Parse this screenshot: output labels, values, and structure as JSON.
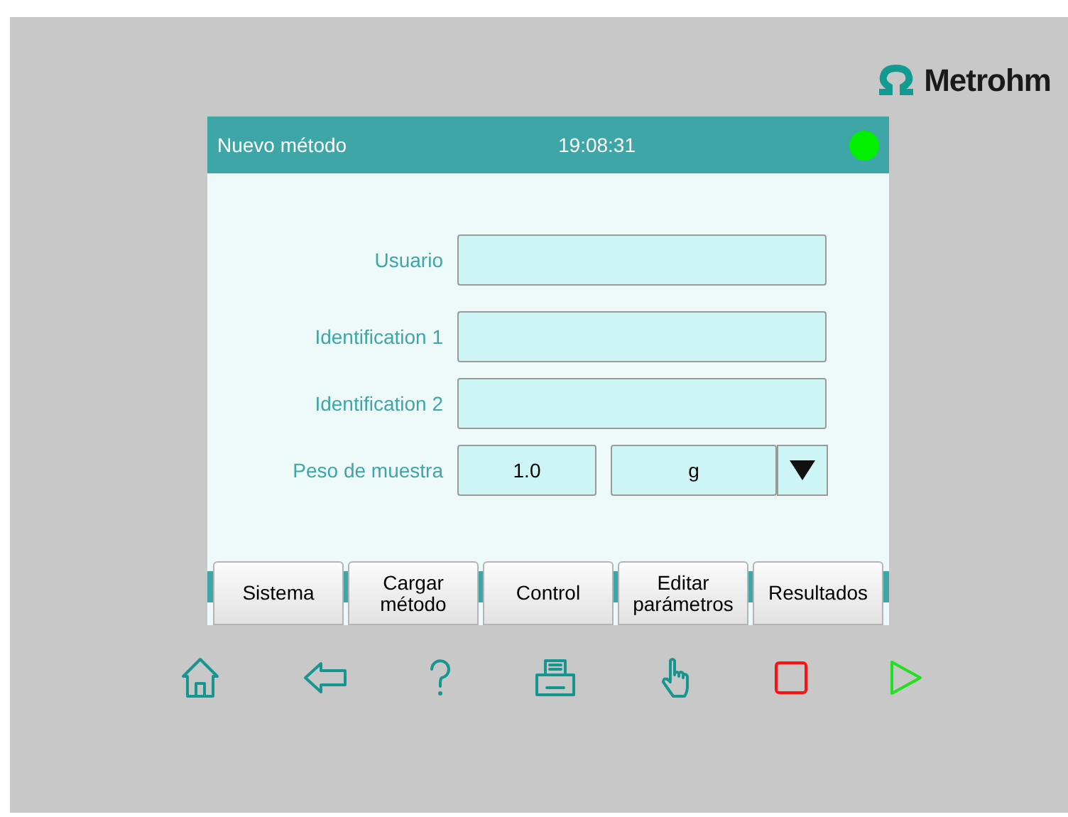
{
  "logo": {
    "text": "Metrohm"
  },
  "header": {
    "title": "Nuevo método",
    "time": "19:08:31",
    "status_light": {
      "on": true
    }
  },
  "fields": [
    {
      "kind": "text",
      "label": "Usuario"
    },
    {
      "kind": "text",
      "label": "Identification 1"
    },
    {
      "kind": "text",
      "label": "Identification 2"
    },
    {
      "kind": "number_unit",
      "label": "Peso de muestra",
      "value": "1.0",
      "unit": "g"
    }
  ],
  "buttons": [
    {
      "label": "Sistema"
    },
    {
      "label": "Cargar\nmétodo"
    },
    {
      "label": "Control"
    },
    {
      "label": "Editar\nparámetros"
    },
    {
      "label": "Resultados"
    }
  ],
  "toolbar": [
    {
      "kind": "home"
    },
    {
      "kind": "back"
    },
    {
      "kind": "help"
    },
    {
      "kind": "print"
    },
    {
      "kind": "manual"
    },
    {
      "kind": "stop"
    },
    {
      "kind": "start"
    }
  ]
}
